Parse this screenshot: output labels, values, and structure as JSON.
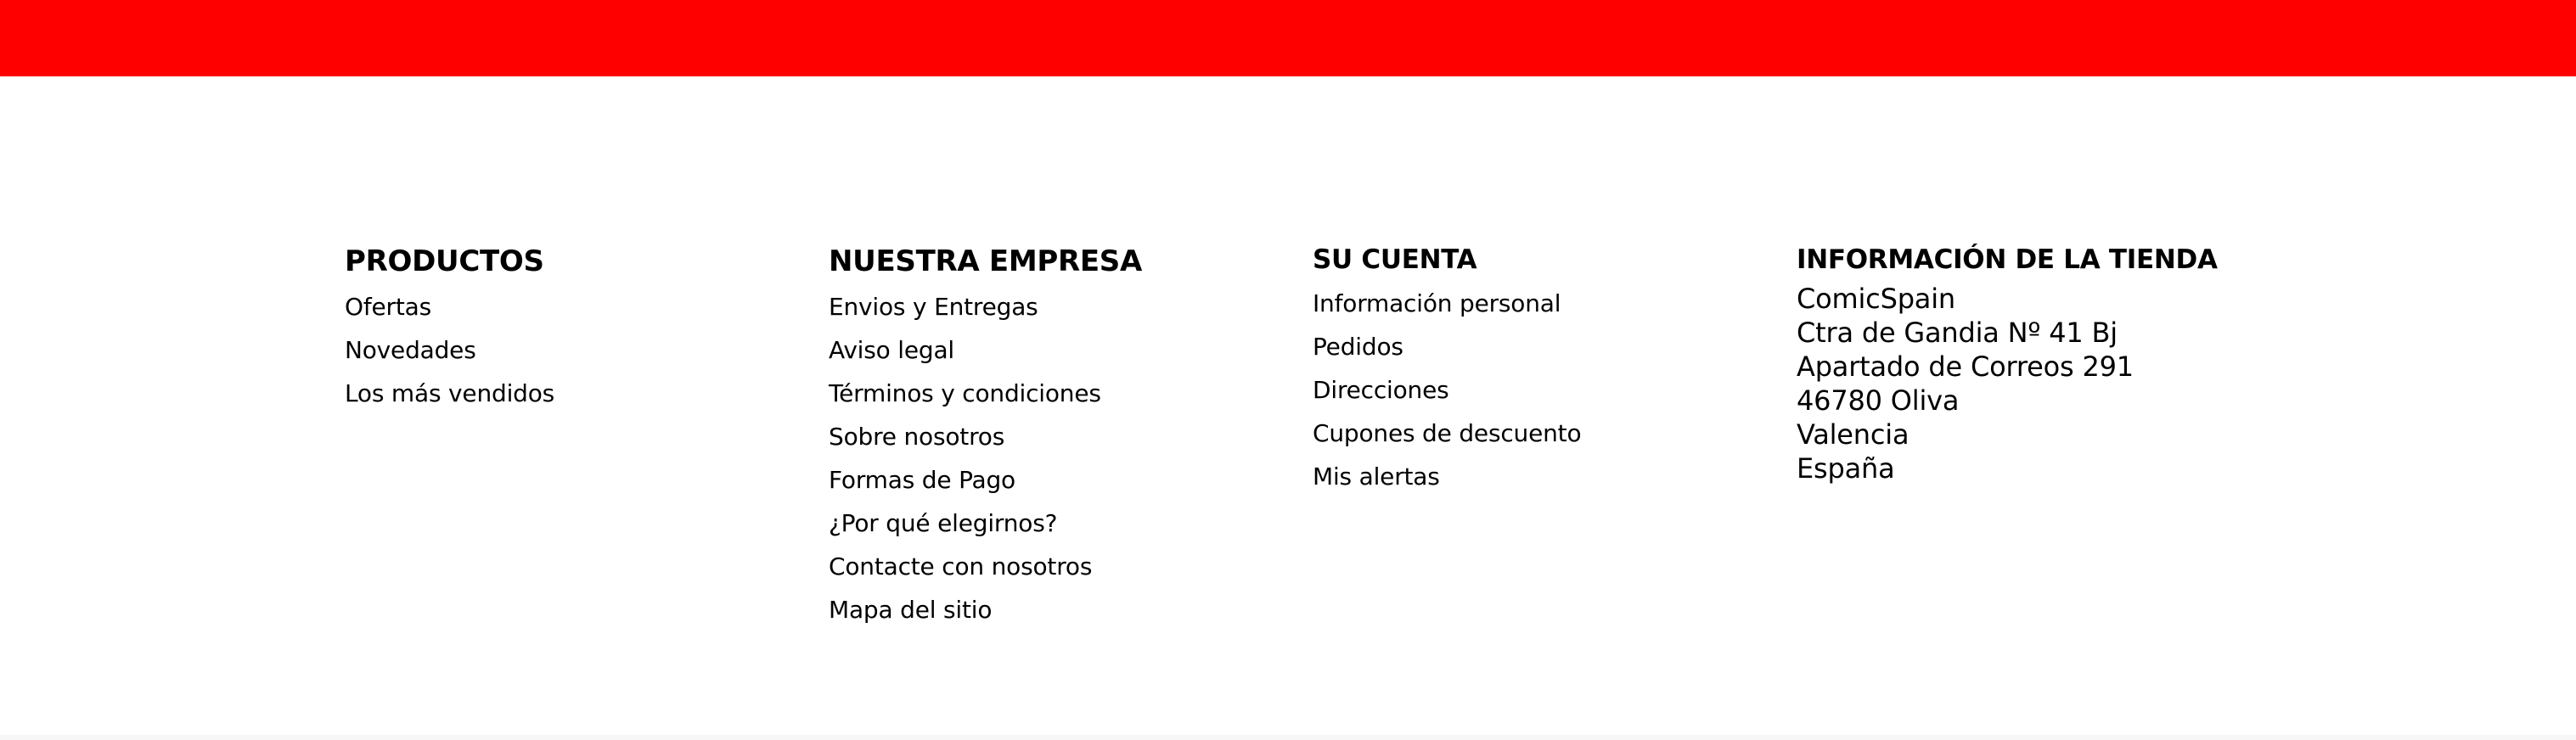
{
  "brand_color": "#ff0000",
  "footer": {
    "productos": {
      "heading": "PRODUCTOS",
      "links": [
        "Ofertas",
        "Novedades",
        "Los más vendidos"
      ]
    },
    "empresa": {
      "heading": "NUESTRA EMPRESA",
      "links": [
        "Envios y Entregas",
        "Aviso legal",
        "Términos y condiciones",
        "Sobre nosotros",
        "Formas de Pago",
        "¿Por qué elegirnos?",
        "Contacte con nosotros",
        "Mapa del sitio"
      ]
    },
    "cuenta": {
      "heading": "SU CUENTA",
      "links": [
        "Información personal",
        "Pedidos",
        "Direcciones",
        "Cupones de descuento",
        "Mis alertas"
      ]
    },
    "tienda": {
      "heading": "INFORMACIÓN DE LA TIENDA",
      "lines": [
        "ComicSpain",
        "Ctra de Gandia Nº 41 Bj",
        "Apartado de Correos 291",
        "46780 Oliva",
        "Valencia",
        "España"
      ]
    }
  }
}
